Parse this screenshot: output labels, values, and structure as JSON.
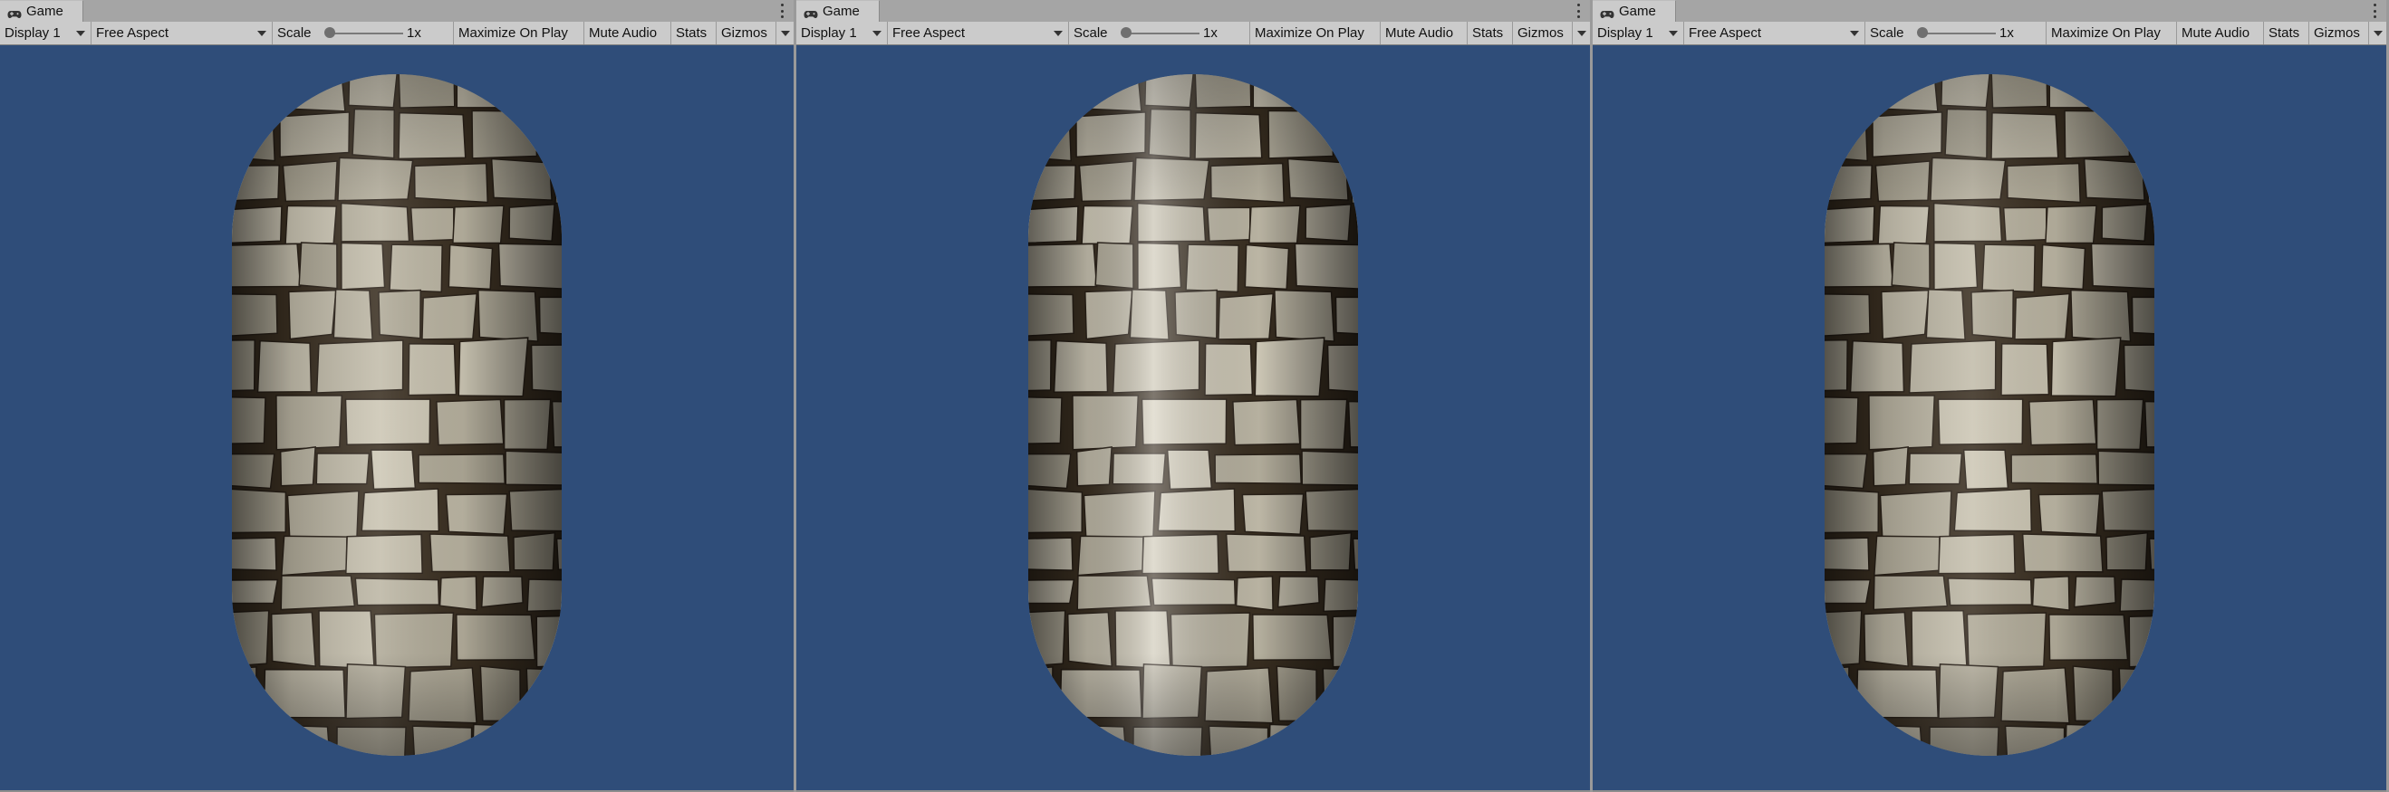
{
  "colors": {
    "viewport_bg": "#2f4d79",
    "toolbar_bg": "#cbcbcb",
    "stone_light": "#c9bea6",
    "stone_dark": "#3b3022"
  },
  "panels": [
    {
      "tab": {
        "title": "Game",
        "icon": "gamepad-icon"
      },
      "toolbar": {
        "display": "Display 1",
        "aspect": "Free Aspect",
        "scale_label": "Scale",
        "scale_value": "1x",
        "maximize": "Maximize On Play",
        "mute": "Mute Audio",
        "stats": "Stats",
        "gizmos": "Gizmos"
      },
      "scene": {
        "object": "stone-capsule",
        "shading": "matte"
      }
    },
    {
      "tab": {
        "title": "Game",
        "icon": "gamepad-icon"
      },
      "toolbar": {
        "display": "Display 1",
        "aspect": "Free Aspect",
        "scale_label": "Scale",
        "scale_value": "1x",
        "maximize": "Maximize On Play",
        "mute": "Mute Audio",
        "stats": "Stats",
        "gizmos": "Gizmos"
      },
      "scene": {
        "object": "stone-capsule",
        "shading": "glossy"
      }
    },
    {
      "tab": {
        "title": "Game",
        "icon": "gamepad-icon"
      },
      "toolbar": {
        "display": "Display 1",
        "aspect": "Free Aspect",
        "scale_label": "Scale",
        "scale_value": "1x",
        "maximize": "Maximize On Play",
        "mute": "Mute Audio",
        "stats": "Stats",
        "gizmos": "Gizmos"
      },
      "scene": {
        "object": "stone-capsule",
        "shading": "matte"
      }
    }
  ]
}
